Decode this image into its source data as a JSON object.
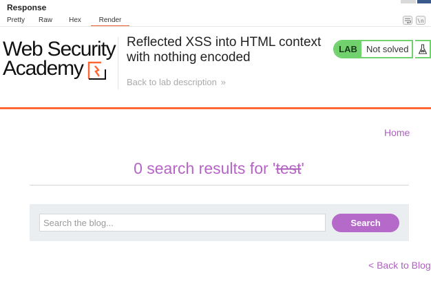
{
  "panel": {
    "title": "Response",
    "tabs": [
      {
        "label": "Pretty"
      },
      {
        "label": "Raw"
      },
      {
        "label": "Hex"
      },
      {
        "label": "Render",
        "active": true
      }
    ],
    "tool_icons": [
      "word-wrap-icon",
      "newline-icon"
    ],
    "accent_color": "#e8602c"
  },
  "lab": {
    "logo_line1": "Web Security",
    "logo_line2": "Academy",
    "title": "Reflected XSS into HTML context with nothing encoded",
    "back_link": "Back to lab description",
    "back_chevron": "»",
    "badge": "LAB",
    "status": "Not solved",
    "status_color": "#70d16d",
    "rule_color": "#ff6633",
    "flask_icon": "flask-icon"
  },
  "blog": {
    "home_link": "Home",
    "results_prefix": "0 search results for '",
    "search_term": "test",
    "results_suffix": "'",
    "search_placeholder": "Search the blog...",
    "search_button": "Search",
    "back_link": "< Back to Blog",
    "link_color": "#b05ec3"
  }
}
